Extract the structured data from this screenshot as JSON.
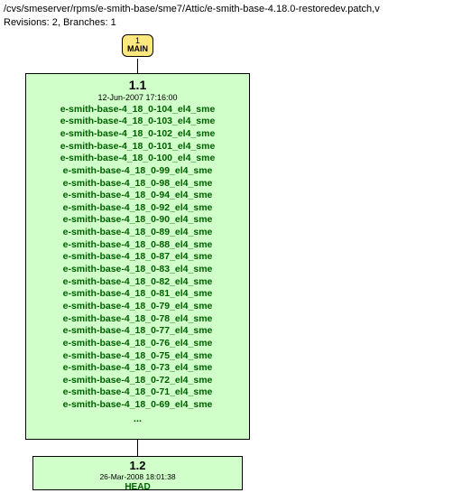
{
  "header": {
    "path": "/cvs/smeserver/rpms/e-smith-base/sme7/Attic/e-smith-base-4.18.0-restoredev.patch,v",
    "meta": "Revisions: 2, Branches: 1"
  },
  "branch": {
    "num": "1",
    "name": "MAIN"
  },
  "rev11": {
    "title": "1.1",
    "date": "12-Jun-2007 17:16:00",
    "tags": [
      "e-smith-base-4_18_0-104_el4_sme",
      "e-smith-base-4_18_0-103_el4_sme",
      "e-smith-base-4_18_0-102_el4_sme",
      "e-smith-base-4_18_0-101_el4_sme",
      "e-smith-base-4_18_0-100_el4_sme",
      "e-smith-base-4_18_0-99_el4_sme",
      "e-smith-base-4_18_0-98_el4_sme",
      "e-smith-base-4_18_0-94_el4_sme",
      "e-smith-base-4_18_0-92_el4_sme",
      "e-smith-base-4_18_0-90_el4_sme",
      "e-smith-base-4_18_0-89_el4_sme",
      "e-smith-base-4_18_0-88_el4_sme",
      "e-smith-base-4_18_0-87_el4_sme",
      "e-smith-base-4_18_0-83_el4_sme",
      "e-smith-base-4_18_0-82_el4_sme",
      "e-smith-base-4_18_0-81_el4_sme",
      "e-smith-base-4_18_0-79_el4_sme",
      "e-smith-base-4_18_0-78_el4_sme",
      "e-smith-base-4_18_0-77_el4_sme",
      "e-smith-base-4_18_0-76_el4_sme",
      "e-smith-base-4_18_0-75_el4_sme",
      "e-smith-base-4_18_0-73_el4_sme",
      "e-smith-base-4_18_0-72_el4_sme",
      "e-smith-base-4_18_0-71_el4_sme",
      "e-smith-base-4_18_0-69_el4_sme"
    ],
    "ellipsis": "..."
  },
  "rev12": {
    "title": "1.2",
    "date": "26-Mar-2008 18:01:38",
    "tag": "HEAD"
  }
}
